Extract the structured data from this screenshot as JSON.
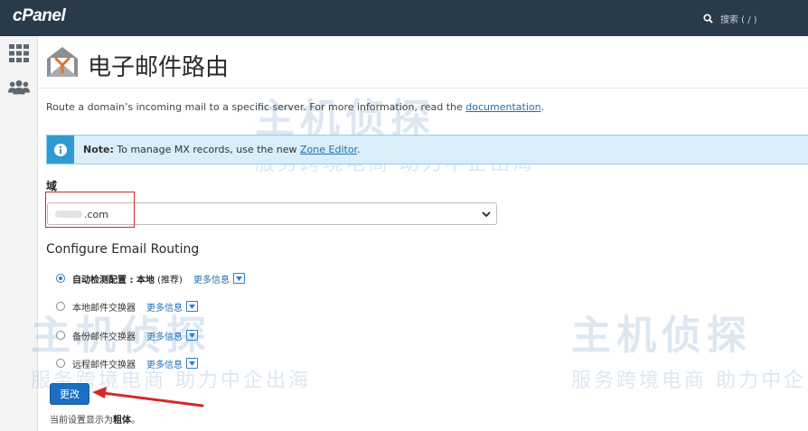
{
  "app": {
    "logo": "cPanel"
  },
  "search": {
    "label": "搜索 ( / )",
    "icon": "search-icon"
  },
  "sidebar": {
    "items": [
      {
        "icon": "grid-icon"
      },
      {
        "icon": "users-icon"
      }
    ]
  },
  "page": {
    "title": "电子邮件路由",
    "description_prefix": "Route a domain’s incoming mail to a specific server. For more information, read the ",
    "description_link": "documentation",
    "description_suffix": "."
  },
  "note": {
    "bold": "Note:",
    "text": " To manage MX records, use the new ",
    "link": "Zone Editor",
    "suffix": "."
  },
  "domain_field": {
    "label": "域",
    "value": ".com"
  },
  "routing": {
    "heading": "Configure Email Routing",
    "more_label": "更多信息",
    "options": [
      {
        "label": "自动检测配置 : 本地",
        "suffix": " (推荐)",
        "checked": true
      },
      {
        "label": "本地邮件交换器",
        "suffix": "",
        "checked": false
      },
      {
        "label": "备份邮件交换器",
        "suffix": "",
        "checked": false
      },
      {
        "label": "远程邮件交换器",
        "suffix": "",
        "checked": false
      }
    ]
  },
  "submit": {
    "label": "更改"
  },
  "footnote": {
    "text": "当前设置显示为",
    "bold": "粗体",
    "end": "。"
  },
  "watermark": {
    "title": "主机侦探",
    "subtitle": "服务跨境电商 助力中企出海"
  },
  "colors": {
    "topbar": "#293a4a",
    "accent": "#1a6fc2",
    "annotation": "#d42a2a"
  }
}
